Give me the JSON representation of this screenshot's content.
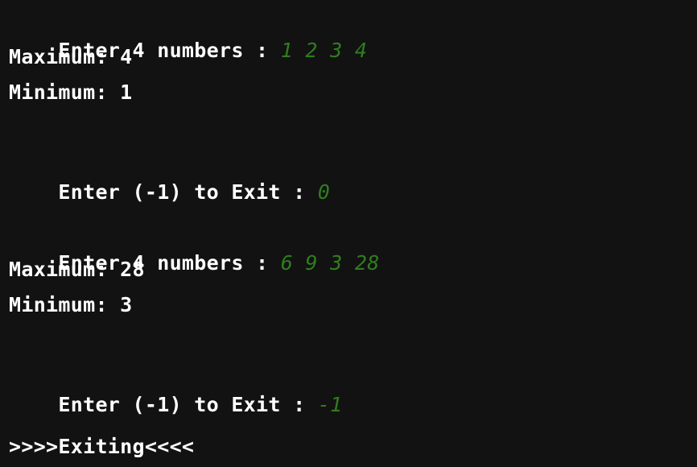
{
  "console": {
    "lines": [
      {
        "kind": "prompt",
        "prompt": "Enter 4 numbers : ",
        "input": "1 2 3 4"
      },
      {
        "kind": "output",
        "text": "Maximum: 4"
      },
      {
        "kind": "output",
        "text": "Minimum: 1"
      },
      {
        "kind": "blank",
        "text": ""
      },
      {
        "kind": "prompt",
        "prompt": "Enter (-1) to Exit : ",
        "input": "0"
      },
      {
        "kind": "blank",
        "text": ""
      },
      {
        "kind": "prompt",
        "prompt": "Enter 4 numbers : ",
        "input": "6 9 3 28"
      },
      {
        "kind": "output",
        "text": "Maximum: 28"
      },
      {
        "kind": "output",
        "text": "Minimum: 3"
      },
      {
        "kind": "blank",
        "text": ""
      },
      {
        "kind": "prompt",
        "prompt": "Enter (-1) to Exit : ",
        "input": "-1"
      },
      {
        "kind": "blank",
        "text": ""
      },
      {
        "kind": "output",
        "text": ">>>>Exiting<<<<"
      }
    ]
  },
  "colors": {
    "background": "#121212",
    "output_text": "#ffffff",
    "user_input": "#2f7d1e"
  }
}
